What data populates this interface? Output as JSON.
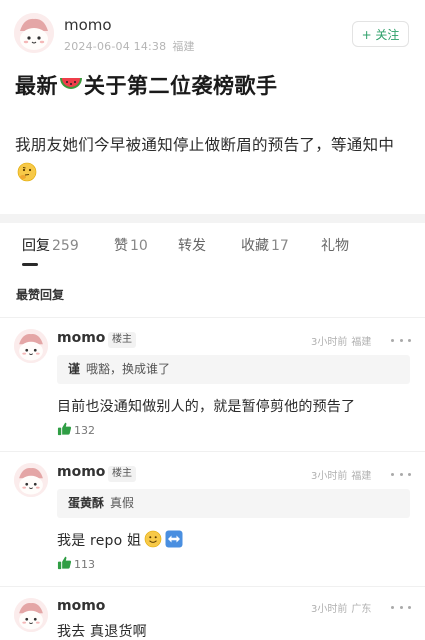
{
  "post": {
    "author": "momo",
    "date": "2024-06-04 14:38",
    "location": "福建",
    "follow_label": "+ 关注",
    "title_before": "最新",
    "title_after": "关于第二位袭榜歌手",
    "body": "我朋友她们今早被通知停止做断眉的预告了，等通知中"
  },
  "tabs": [
    {
      "label": "回复",
      "count": "259"
    },
    {
      "label": "赞",
      "count": "10"
    },
    {
      "label": "转发",
      "count": ""
    },
    {
      "label": "收藏",
      "count": "17"
    },
    {
      "label": "礼物",
      "count": ""
    }
  ],
  "section_label": "最赞回复",
  "comments": [
    {
      "name": "momo",
      "badge": "楼主",
      "time": "3小时前",
      "location": "福建",
      "quote_author": "谨",
      "quote_text": "哦豁，换成谁了",
      "text": "目前也没通知做别人的，就是暂停剪他的预告了",
      "likes": "132"
    },
    {
      "name": "momo",
      "badge": "楼主",
      "time": "3小时前",
      "location": "福建",
      "quote_author": "蛋黄酥",
      "quote_text": "真假",
      "text": "我是 repo 姐",
      "likes": "113"
    },
    {
      "name": "momo",
      "time": "3小时前",
      "location": "广东",
      "text": "我去 真退货啊"
    }
  ],
  "colors": {
    "accent_green": "#2ea06a",
    "like_green": "#2f9e44",
    "avatar_bg": "#fbecec"
  }
}
